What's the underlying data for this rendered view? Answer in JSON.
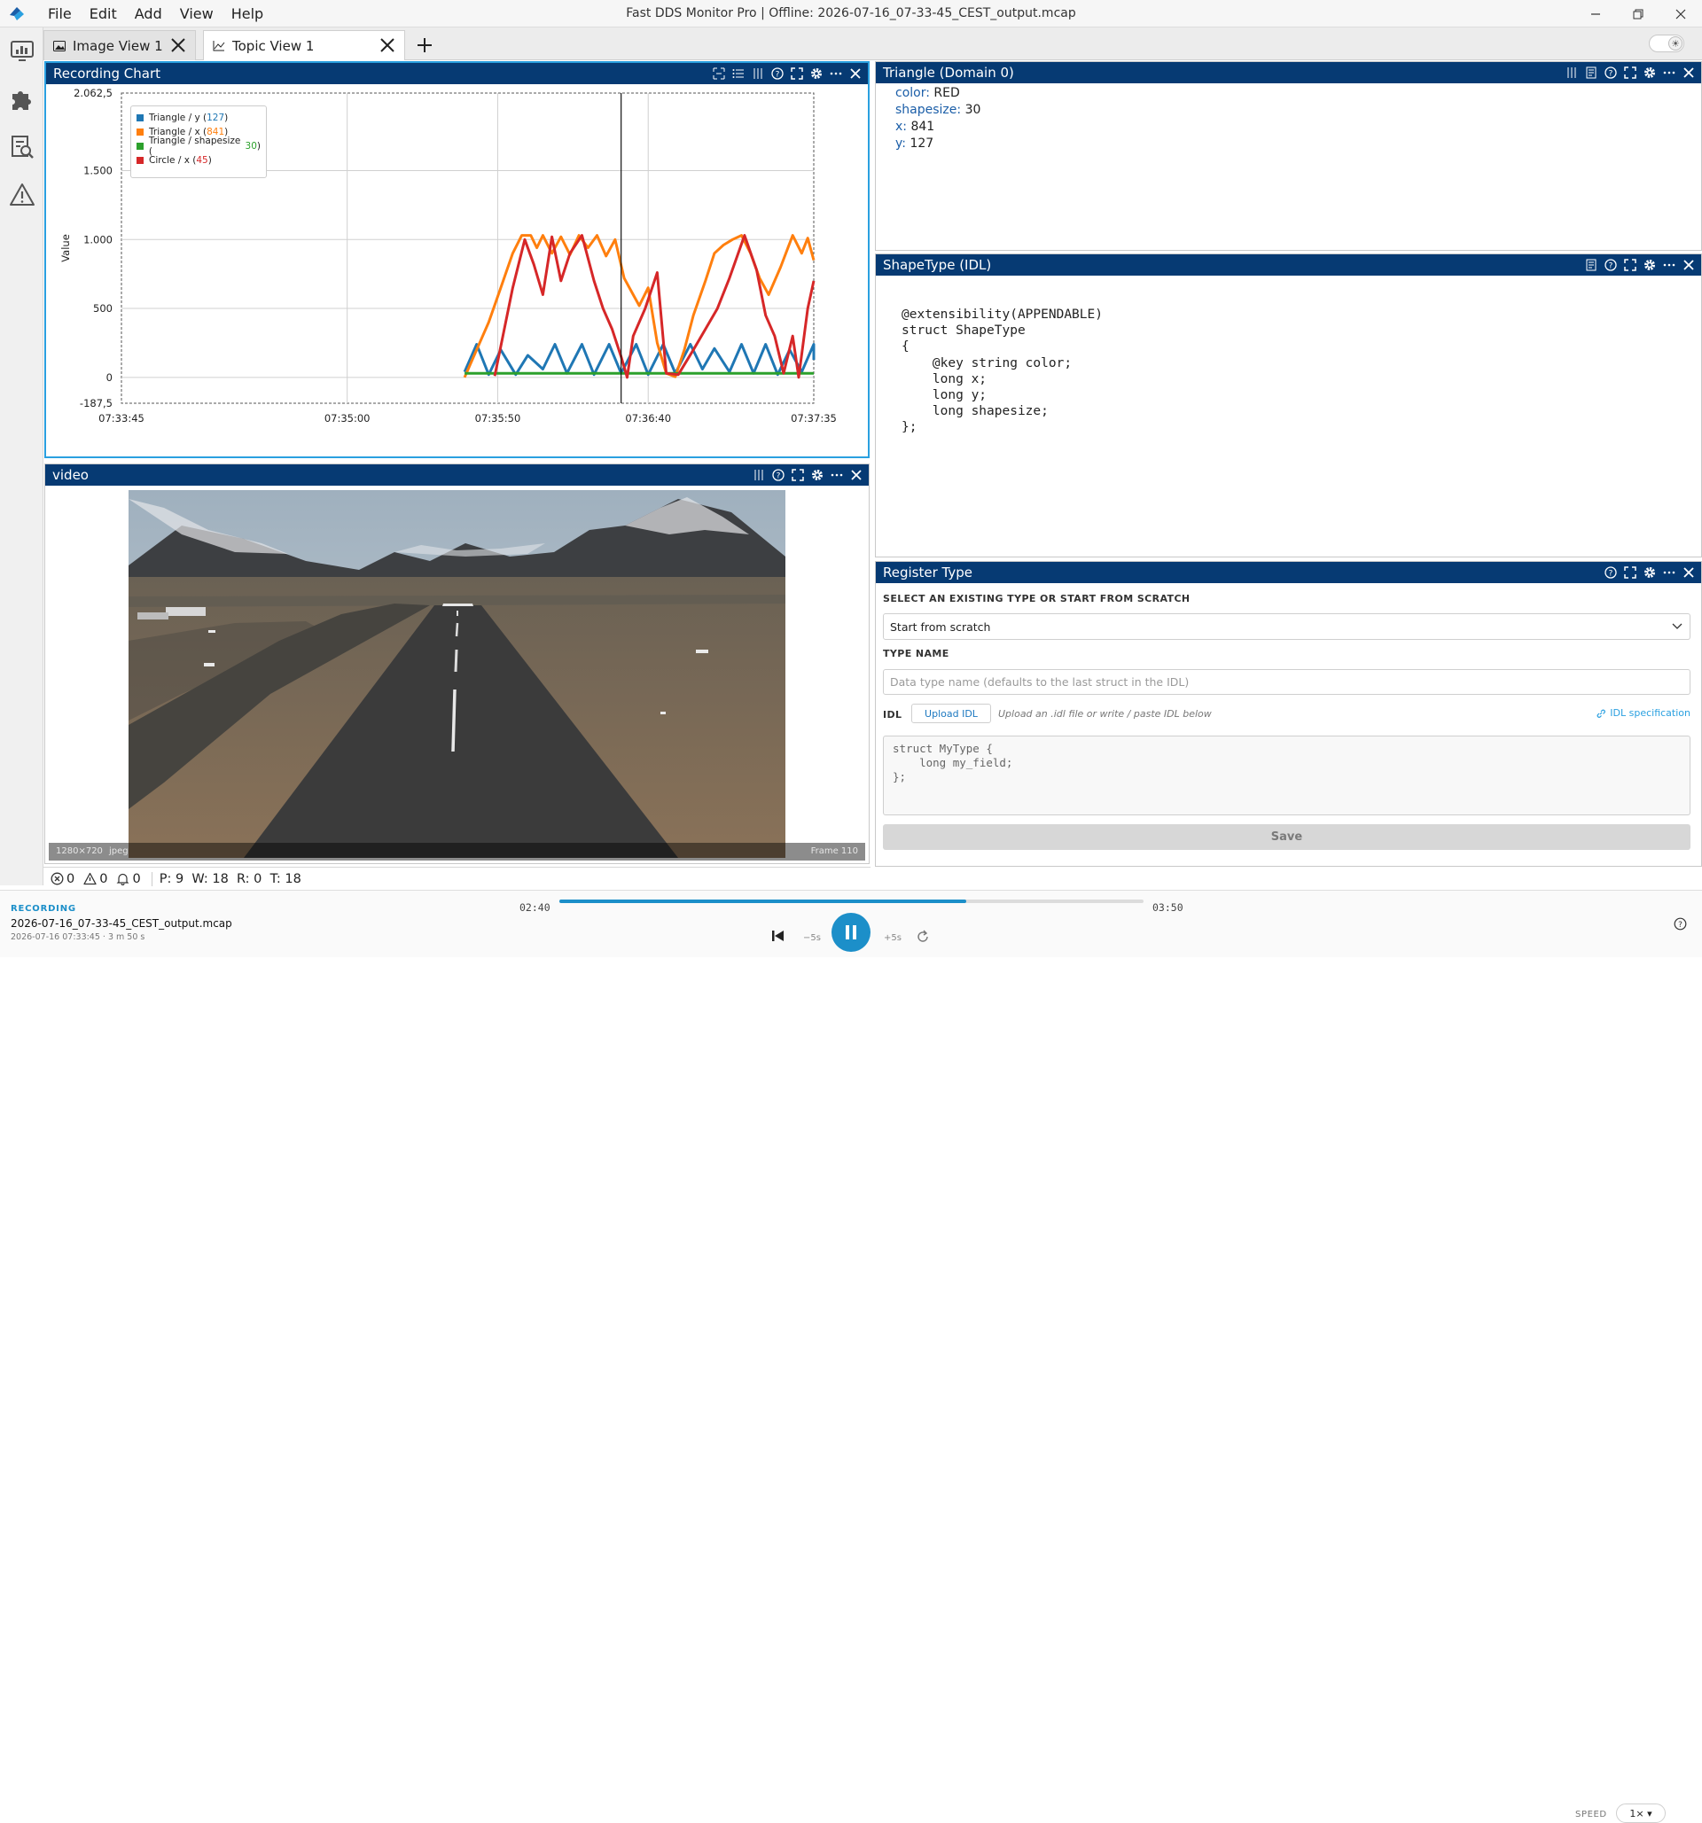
{
  "app": {
    "title": "Fast DDS Monitor Pro  |  Offline: 2026-07-16_07-33-45_CEST_output.mcap",
    "menu": [
      "File",
      "Edit",
      "Add",
      "View",
      "Help"
    ]
  },
  "tabs": [
    {
      "label": "Image View 1",
      "icon": "image-icon",
      "active": false
    },
    {
      "label": "Topic View 1",
      "icon": "chart-icon",
      "active": true
    }
  ],
  "panels": {
    "chart": {
      "title": "Recording Chart",
      "ylabel": "Value"
    },
    "video": {
      "title": "video",
      "resolution": "1280×720",
      "format": "jpeg",
      "frame": "Frame 110"
    },
    "triangle": {
      "title": "Triangle (Domain 0)",
      "fields": [
        {
          "key": "color:",
          "value": "RED"
        },
        {
          "key": "shapesize:",
          "value": "30"
        },
        {
          "key": "x:",
          "value": "841"
        },
        {
          "key": "y:",
          "value": "127"
        }
      ]
    },
    "idl": {
      "title": "ShapeType (IDL)",
      "code": "@extensibility(APPENDABLE)\nstruct ShapeType\n{\n    @key string color;\n    long x;\n    long y;\n    long shapesize;\n};"
    },
    "register": {
      "title": "Register Type",
      "select_label": "SELECT AN EXISTING TYPE OR START FROM SCRATCH",
      "select_value": "Start from scratch",
      "type_name_label": "TYPE NAME",
      "type_name_placeholder": "Data type name (defaults to the last struct in the IDL)",
      "idl_label": "IDL",
      "upload_label": "Upload IDL",
      "upload_hint": "Upload an .idl file or write / paste IDL below",
      "spec_link": "IDL specification",
      "idl_placeholder": "struct MyType {\n    long my_field;\n};",
      "save_label": "Save"
    }
  },
  "chart_data": {
    "type": "line",
    "xlabel": "",
    "ylabel": "Value",
    "x_ticks": [
      "07:33:45",
      "07:35:00",
      "07:35:50",
      "07:36:40",
      "07:37:35"
    ],
    "y_ticks": [
      "2.062,5",
      "1.500",
      "1.000",
      "500",
      "0",
      "-187,5"
    ],
    "ylim": [
      -187.5,
      2062.5
    ],
    "xlim_seconds": [
      0,
      230
    ],
    "cursor_time_s": 166,
    "grid": true,
    "legend_position": "top-left",
    "series": [
      {
        "name": "Triangle / y",
        "value_label": "127",
        "color": "#1f77b4",
        "points": [
          [
            114,
            40
          ],
          [
            118,
            240
          ],
          [
            122,
            20
          ],
          [
            126,
            200
          ],
          [
            131,
            20
          ],
          [
            135,
            160
          ],
          [
            140,
            60
          ],
          [
            144,
            240
          ],
          [
            148,
            30
          ],
          [
            153,
            240
          ],
          [
            157,
            20
          ],
          [
            162,
            240
          ],
          [
            166,
            30
          ],
          [
            171,
            240
          ],
          [
            175,
            20
          ],
          [
            180,
            240
          ],
          [
            184,
            30
          ],
          [
            189,
            240
          ],
          [
            193,
            60
          ],
          [
            197,
            210
          ],
          [
            202,
            40
          ],
          [
            206,
            240
          ],
          [
            210,
            30
          ],
          [
            214,
            240
          ],
          [
            218,
            20
          ],
          [
            222,
            200
          ],
          [
            226,
            40
          ],
          [
            230,
            240
          ],
          [
            230,
            127
          ]
        ]
      },
      {
        "name": "Triangle / x",
        "value_label": "841",
        "color": "#ff7f0e",
        "points": [
          [
            114,
            0
          ],
          [
            118,
            200
          ],
          [
            122,
            400
          ],
          [
            126,
            650
          ],
          [
            130,
            900
          ],
          [
            133,
            1030
          ],
          [
            136,
            1030
          ],
          [
            138,
            940
          ],
          [
            140,
            1030
          ],
          [
            143,
            900
          ],
          [
            146,
            1020
          ],
          [
            149,
            890
          ],
          [
            152,
            1030
          ],
          [
            155,
            940
          ],
          [
            158,
            1030
          ],
          [
            161,
            880
          ],
          [
            164,
            1000
          ],
          [
            167,
            720
          ],
          [
            170,
            600
          ],
          [
            172,
            520
          ],
          [
            175,
            650
          ],
          [
            178,
            250
          ],
          [
            181,
            30
          ],
          [
            184,
            5
          ],
          [
            187,
            200
          ],
          [
            190,
            450
          ],
          [
            194,
            700
          ],
          [
            197,
            900
          ],
          [
            200,
            960
          ],
          [
            203,
            1000
          ],
          [
            206,
            1030
          ],
          [
            209,
            900
          ],
          [
            212,
            720
          ],
          [
            215,
            600
          ],
          [
            219,
            800
          ],
          [
            223,
            1030
          ],
          [
            226,
            900
          ],
          [
            228,
            1010
          ],
          [
            230,
            850
          ]
        ]
      },
      {
        "name": "Triangle / shapesize",
        "value_label": "30",
        "color": "#2ca02c",
        "points": [
          [
            114,
            30
          ],
          [
            230,
            30
          ]
        ]
      },
      {
        "name": "Circle / x",
        "value_label": "45",
        "color": "#d62728",
        "points": [
          [
            124,
            10
          ],
          [
            130,
            650
          ],
          [
            134,
            1000
          ],
          [
            137,
            820
          ],
          [
            140,
            600
          ],
          [
            143,
            1020
          ],
          [
            146,
            700
          ],
          [
            149,
            900
          ],
          [
            153,
            1030
          ],
          [
            157,
            700
          ],
          [
            160,
            500
          ],
          [
            163,
            350
          ],
          [
            166,
            150
          ],
          [
            168,
            0
          ],
          [
            170,
            300
          ],
          [
            174,
            500
          ],
          [
            178,
            760
          ],
          [
            181,
            30
          ],
          [
            185,
            20
          ],
          [
            190,
            200
          ],
          [
            194,
            350
          ],
          [
            198,
            500
          ],
          [
            202,
            720
          ],
          [
            207,
            1030
          ],
          [
            211,
            780
          ],
          [
            214,
            450
          ],
          [
            217,
            300
          ],
          [
            220,
            30
          ],
          [
            223,
            300
          ],
          [
            225,
            0
          ],
          [
            228,
            500
          ],
          [
            230,
            700
          ]
        ]
      }
    ]
  },
  "status": {
    "errors": "0",
    "warnings": "0",
    "notifications": "0",
    "counts": "P: 9  W: 18  R: 0  T: 18"
  },
  "player": {
    "badge": "RECORDING",
    "filename": "2026-07-16_07-33-45_CEST_output.mcap",
    "meta": "2026-07-16  07:33:45  ·  3 m 50 s",
    "current_time": "02:40",
    "total_time": "03:50",
    "progress_fraction": 0.697,
    "skip_back": "−5s",
    "skip_fwd": "+5s",
    "speed_label": "SPEED",
    "speed_value": "1× ▾"
  }
}
